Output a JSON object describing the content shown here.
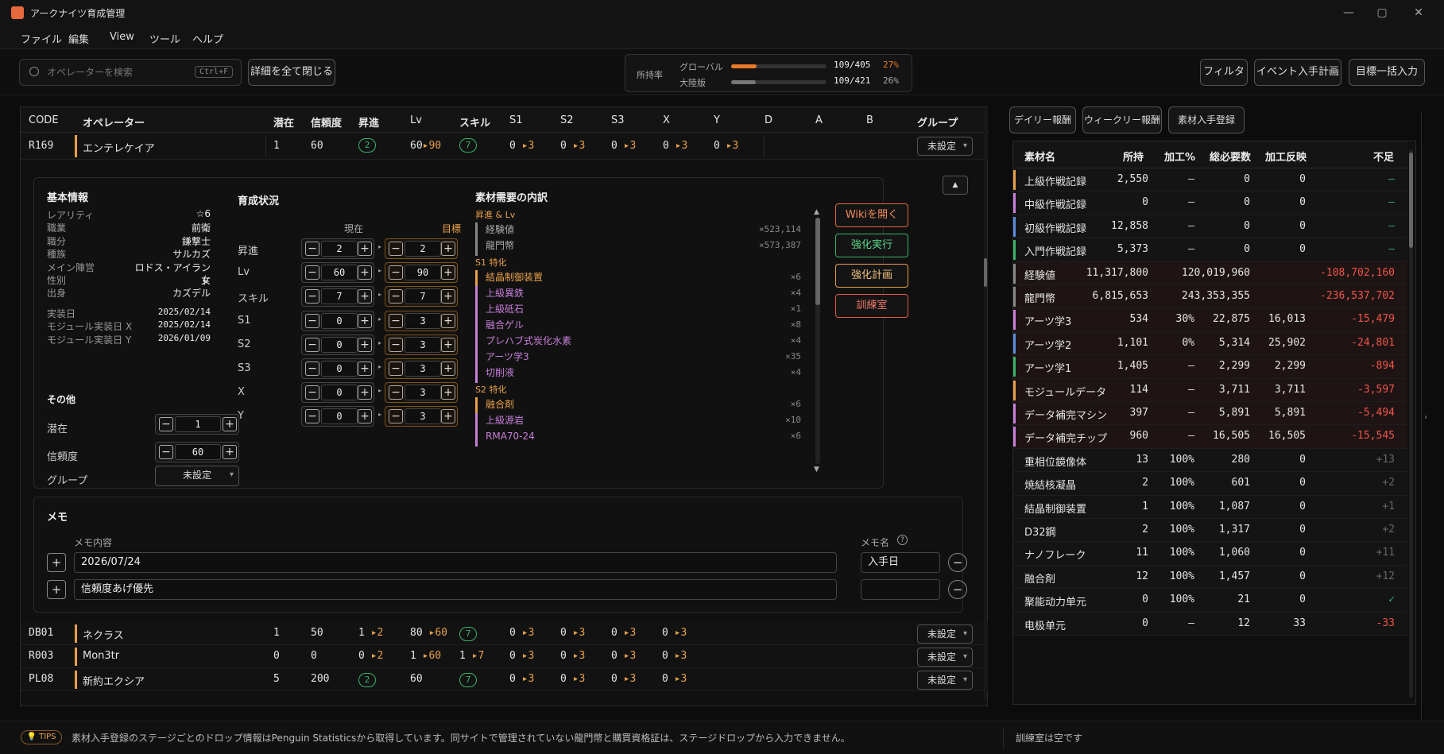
{
  "window": {
    "title": "アークナイツ育成管理"
  },
  "menu": [
    "ファイル",
    "編集",
    "View",
    "ツール",
    "ヘルプ"
  ],
  "toolbar": {
    "search_placeholder": "オペレーターを検索",
    "search_shortcut": "Ctrl+F",
    "collapse_label": "詳細を全て閉じる",
    "filter_label": "フィルタ",
    "event_label": "イベント入手計画",
    "target_label": "目標一括入力"
  },
  "stats": {
    "label": "所持率",
    "rows": [
      {
        "name": "グローバル",
        "count": "109/405",
        "pct": "27%",
        "fill": 0.27,
        "color": "#e87a2a"
      },
      {
        "name": "大陸版",
        "count": "109/421",
        "pct": "26%",
        "fill": 0.26,
        "color": "#777777"
      }
    ]
  },
  "table": {
    "headers": [
      "CODE",
      "オペレーター",
      "潜在",
      "信頼度",
      "昇進",
      "Lv",
      "スキル",
      "S1",
      "S2",
      "S3",
      "X",
      "Y",
      "D",
      "A",
      "B",
      "グループ"
    ]
  },
  "expanded": {
    "code": "R169",
    "name": "エンテレケイア",
    "pot": "1",
    "trust": "60",
    "elite": "2",
    "lv": "60",
    "lv_to": "90",
    "skill": "7",
    "mods": [
      "0",
      "0",
      "0",
      "0",
      "0"
    ],
    "mod_to": "3",
    "group": "未設定"
  },
  "basic": {
    "title": "基本情報",
    "items": [
      {
        "k": "レアリティ",
        "v": "☆6"
      },
      {
        "k": "職業",
        "v": "前衛"
      },
      {
        "k": "職分",
        "v": "鎌撃士"
      },
      {
        "k": "種族",
        "v": "サルカズ"
      },
      {
        "k": "メイン陣営",
        "v": "ロドス・アイランド"
      },
      {
        "k": "性別",
        "v": "女"
      },
      {
        "k": "出身",
        "v": "カズデル"
      }
    ],
    "dates": [
      {
        "k": "実装日",
        "v": "2025/02/14"
      },
      {
        "k": "モジュール実装日 X",
        "v": "2025/02/14"
      },
      {
        "k": "モジュール実装日 Y",
        "v": "2026/01/09"
      }
    ],
    "other_title": "その他",
    "pot_label": "潜在",
    "pot": "1",
    "trust_label": "信頼度",
    "trust": "60",
    "group_label": "グループ",
    "group": "未設定"
  },
  "growth": {
    "title": "育成状況",
    "current_label": "現在",
    "target_label": "目標",
    "rows": [
      {
        "k": "昇進",
        "cur": "2",
        "tgt": "2"
      },
      {
        "k": "Lv",
        "cur": "60",
        "tgt": "90"
      },
      {
        "k": "スキル",
        "cur": "7",
        "tgt": "7"
      },
      {
        "k": "S1",
        "cur": "0",
        "tgt": "3"
      },
      {
        "k": "S2",
        "cur": "0",
        "tgt": "3"
      },
      {
        "k": "S3",
        "cur": "0",
        "tgt": "3"
      },
      {
        "k": "X",
        "cur": "0",
        "tgt": "3"
      },
      {
        "k": "Y",
        "cur": "0",
        "tgt": "3"
      }
    ]
  },
  "breakdown": {
    "title": "素材需要の内訳",
    "items": [
      {
        "head": "昇進 & Lv"
      },
      {
        "name": "経験値",
        "qty": "×523,114",
        "c": "#888888"
      },
      {
        "name": "龍門幣",
        "qty": "×573,387",
        "c": "#888888"
      },
      {
        "head": "S1 特化"
      },
      {
        "name": "結晶制御装置",
        "qty": "×6",
        "c": "#e8a04a"
      },
      {
        "name": "上級異鉄",
        "qty": "×4",
        "c": "#c77fd9"
      },
      {
        "name": "上級砥石",
        "qty": "×1",
        "c": "#c77fd9"
      },
      {
        "name": "融合ゲル",
        "qty": "×8",
        "c": "#c77fd9"
      },
      {
        "name": "プレハブ式炭化水素",
        "qty": "×4",
        "c": "#c77fd9"
      },
      {
        "name": "アーツ学3",
        "qty": "×35",
        "c": "#c77fd9"
      },
      {
        "name": "切削液",
        "qty": "×4",
        "c": "#c77fd9"
      },
      {
        "head": "S2 特化"
      },
      {
        "name": "融合剤",
        "qty": "×6",
        "c": "#e8a04a"
      },
      {
        "name": "上級源岩",
        "qty": "×10",
        "c": "#c77fd9"
      },
      {
        "name": "RMA70-24",
        "qty": "×6",
        "c": "#c77fd9"
      }
    ]
  },
  "actions": {
    "wiki": "Wikiを開く",
    "exec": "強化実行",
    "plan": "強化計画",
    "train": "訓練室"
  },
  "memo": {
    "title": "メモ",
    "content_label": "メモ内容",
    "name_label": "メモ名",
    "rows": [
      {
        "content": "2026/07/24",
        "name": "入手日"
      },
      {
        "content": "信頼度あげ優先",
        "name": ""
      }
    ]
  },
  "rows": [
    {
      "code": "DB01",
      "name": "ネクラス",
      "pot": "1",
      "trust": "50",
      "elite": "1",
      "elite_to": "2",
      "lv": "80",
      "lv_to": "60",
      "skill": "7",
      "s1": "0",
      "s2": "0",
      "s3": "0",
      "x": "0",
      "group": "未設定"
    },
    {
      "code": "R003",
      "name": "Mon3tr",
      "pot": "0",
      "trust": "0",
      "elite": "0",
      "elite_to": "2",
      "lv": "1",
      "lv_to": "60",
      "skill": "1",
      "skill_to": "7",
      "s1": "0",
      "s2": "0",
      "s3": "0",
      "x": "0",
      "group": "未設定"
    },
    {
      "code": "PL08",
      "name": "新約エクシア",
      "pot": "5",
      "trust": "200",
      "elite": "2",
      "lv": "60",
      "skill": "7",
      "s1": "0",
      "s2": "0",
      "s3": "0",
      "x": "0",
      "group": "未設定"
    }
  ],
  "right": {
    "tabs": [
      "デイリー報酬",
      "ウィークリー報酬",
      "素材入手登録"
    ],
    "headers": [
      "素材名",
      "所持",
      "加工%",
      "総必要数",
      "加工反映",
      "不足"
    ],
    "rows": [
      {
        "name": "上級作戦記録",
        "own": "2,550",
        "proc": "–",
        "total": "0",
        "refl": "0",
        "short": "–",
        "c": "#e8a04a",
        "bg": "#141414",
        "sc": "#3bb36a"
      },
      {
        "name": "中級作戦記録",
        "own": "0",
        "proc": "–",
        "total": "0",
        "refl": "0",
        "short": "–",
        "c": "#c77fd9",
        "bg": "#141414",
        "sc": "#3bb36a"
      },
      {
        "name": "初級作戦記録",
        "own": "12,858",
        "proc": "–",
        "total": "0",
        "refl": "0",
        "short": "–",
        "c": "#5a8de0",
        "bg": "#141414",
        "sc": "#3bb36a"
      },
      {
        "name": "入門作戦記録",
        "own": "5,373",
        "proc": "–",
        "total": "0",
        "refl": "0",
        "short": "–",
        "c": "#3bb36a",
        "bg": "#141414",
        "sc": "#3bb36a"
      },
      {
        "name": "経験値",
        "own": "11,317,800",
        "proc": "",
        "total": "120,019,960",
        "refl": "",
        "short": "-108,702,160",
        "c": "#888888",
        "bg": "#1e1414",
        "sc": "#f0554a"
      },
      {
        "name": "龍門幣",
        "own": "6,815,653",
        "proc": "",
        "total": "243,353,355",
        "refl": "",
        "short": "-236,537,702",
        "c": "#888888",
        "bg": "#1e1414",
        "sc": "#f0554a"
      },
      {
        "name": "アーツ学3",
        "own": "534",
        "proc": "30%",
        "total": "22,875",
        "refl": "16,013",
        "short": "-15,479",
        "c": "#c77fd9",
        "bg": "#1e1414",
        "sc": "#f0554a"
      },
      {
        "name": "アーツ学2",
        "own": "1,101",
        "proc": "0%",
        "total": "5,314",
        "refl": "25,902",
        "short": "-24,801",
        "c": "#5a8de0",
        "bg": "#1e1414",
        "sc": "#f0554a"
      },
      {
        "name": "アーツ学1",
        "own": "1,405",
        "proc": "–",
        "total": "2,299",
        "refl": "2,299",
        "short": "-894",
        "c": "#3bb36a",
        "bg": "#1e1414",
        "sc": "#f0554a"
      },
      {
        "name": "モジュールデータ",
        "own": "114",
        "proc": "–",
        "total": "3,711",
        "refl": "3,711",
        "short": "-3,597",
        "c": "#e8a04a",
        "bg": "#1e1414",
        "sc": "#f0554a"
      },
      {
        "name": "データ補完マシン",
        "own": "397",
        "proc": "–",
        "total": "5,891",
        "refl": "5,891",
        "short": "-5,494",
        "c": "#c77fd9",
        "bg": "#1e1414",
        "sc": "#f0554a"
      },
      {
        "name": "データ補完チップ",
        "own": "960",
        "proc": "–",
        "total": "16,505",
        "refl": "16,505",
        "short": "-15,545",
        "c": "#c77fd9",
        "bg": "#1e1414",
        "sc": "#f0554a"
      },
      {
        "name": "重相位鏡像体",
        "own": "13",
        "proc": "100%",
        "total": "280",
        "refl": "0",
        "short": "+13",
        "c": "#141414",
        "bg": "#141414",
        "sc": "#666666"
      },
      {
        "name": "焼結核凝晶",
        "own": "2",
        "proc": "100%",
        "total": "601",
        "refl": "0",
        "short": "+2",
        "c": "#141414",
        "bg": "#141414",
        "sc": "#666666"
      },
      {
        "name": "結晶制御装置",
        "own": "1",
        "proc": "100%",
        "total": "1,087",
        "refl": "0",
        "short": "+1",
        "c": "#141414",
        "bg": "#141414",
        "sc": "#666666"
      },
      {
        "name": "D32鋼",
        "own": "2",
        "proc": "100%",
        "total": "1,317",
        "refl": "0",
        "short": "+2",
        "c": "#141414",
        "bg": "#141414",
        "sc": "#666666"
      },
      {
        "name": "ナノフレーク",
        "own": "11",
        "proc": "100%",
        "total": "1,060",
        "refl": "0",
        "short": "+11",
        "c": "#141414",
        "bg": "#141414",
        "sc": "#666666"
      },
      {
        "name": "融合剤",
        "own": "12",
        "proc": "100%",
        "total": "1,457",
        "refl": "0",
        "short": "+12",
        "c": "#141414",
        "bg": "#141414",
        "sc": "#666666"
      },
      {
        "name": "聚能动力单元",
        "own": "0",
        "proc": "100%",
        "total": "21",
        "refl": "0",
        "short": "✓",
        "c": "#141414",
        "bg": "#141414",
        "sc": "#3bb36a"
      },
      {
        "name": "电极单元",
        "own": "0",
        "proc": "–",
        "total": "12",
        "refl": "33",
        "short": "-33",
        "c": "#141414",
        "bg": "#141414",
        "sc": "#f0554a"
      }
    ]
  },
  "status": {
    "tips_badge": "TIPS",
    "tips_text": "素材入手登録のステージごとのドロップ情報はPenguin Statisticsから取得しています。同サイトで管理されていない龍門幣と購買資格証は、ステージドロップから入力できません。",
    "right": "訓練室は空です"
  }
}
